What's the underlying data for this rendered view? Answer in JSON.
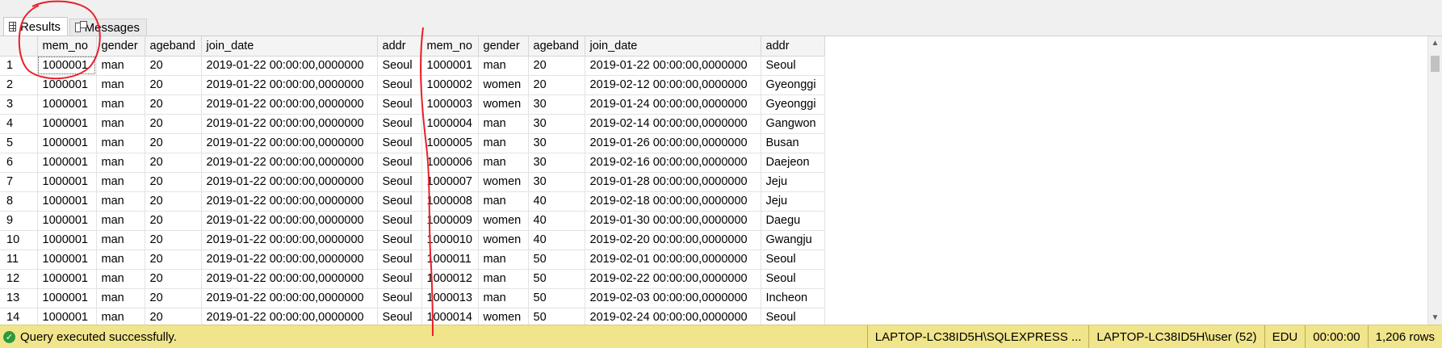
{
  "tabs": {
    "results": "Results",
    "messages": "Messages"
  },
  "columns": [
    "mem_no",
    "gender",
    "ageband",
    "join_date",
    "addr",
    "mem_no",
    "gender",
    "ageband",
    "join_date",
    "addr"
  ],
  "rows": [
    [
      "1",
      "1000001",
      "man",
      "20",
      "2019-01-22 00:00:00,0000000",
      "Seoul",
      "1000001",
      "man",
      "20",
      "2019-01-22 00:00:00,0000000",
      "Seoul"
    ],
    [
      "2",
      "1000001",
      "man",
      "20",
      "2019-01-22 00:00:00,0000000",
      "Seoul",
      "1000002",
      "women",
      "20",
      "2019-02-12 00:00:00,0000000",
      "Gyeonggi"
    ],
    [
      "3",
      "1000001",
      "man",
      "20",
      "2019-01-22 00:00:00,0000000",
      "Seoul",
      "1000003",
      "women",
      "30",
      "2019-01-24 00:00:00,0000000",
      "Gyeonggi"
    ],
    [
      "4",
      "1000001",
      "man",
      "20",
      "2019-01-22 00:00:00,0000000",
      "Seoul",
      "1000004",
      "man",
      "30",
      "2019-02-14 00:00:00,0000000",
      "Gangwon"
    ],
    [
      "5",
      "1000001",
      "man",
      "20",
      "2019-01-22 00:00:00,0000000",
      "Seoul",
      "1000005",
      "man",
      "30",
      "2019-01-26 00:00:00,0000000",
      "Busan"
    ],
    [
      "6",
      "1000001",
      "man",
      "20",
      "2019-01-22 00:00:00,0000000",
      "Seoul",
      "1000006",
      "man",
      "30",
      "2019-02-16 00:00:00,0000000",
      "Daejeon"
    ],
    [
      "7",
      "1000001",
      "man",
      "20",
      "2019-01-22 00:00:00,0000000",
      "Seoul",
      "1000007",
      "women",
      "30",
      "2019-01-28 00:00:00,0000000",
      "Jeju"
    ],
    [
      "8",
      "1000001",
      "man",
      "20",
      "2019-01-22 00:00:00,0000000",
      "Seoul",
      "1000008",
      "man",
      "40",
      "2019-02-18 00:00:00,0000000",
      "Jeju"
    ],
    [
      "9",
      "1000001",
      "man",
      "20",
      "2019-01-22 00:00:00,0000000",
      "Seoul",
      "1000009",
      "women",
      "40",
      "2019-01-30 00:00:00,0000000",
      "Daegu"
    ],
    [
      "10",
      "1000001",
      "man",
      "20",
      "2019-01-22 00:00:00,0000000",
      "Seoul",
      "1000010",
      "women",
      "40",
      "2019-02-20 00:00:00,0000000",
      "Gwangju"
    ],
    [
      "11",
      "1000001",
      "man",
      "20",
      "2019-01-22 00:00:00,0000000",
      "Seoul",
      "1000011",
      "man",
      "50",
      "2019-02-01 00:00:00,0000000",
      "Seoul"
    ],
    [
      "12",
      "1000001",
      "man",
      "20",
      "2019-01-22 00:00:00,0000000",
      "Seoul",
      "1000012",
      "man",
      "50",
      "2019-02-22 00:00:00,0000000",
      "Seoul"
    ],
    [
      "13",
      "1000001",
      "man",
      "20",
      "2019-01-22 00:00:00,0000000",
      "Seoul",
      "1000013",
      "man",
      "50",
      "2019-02-03 00:00:00,0000000",
      "Incheon"
    ],
    [
      "14",
      "1000001",
      "man",
      "20",
      "2019-01-22 00:00:00,0000000",
      "Seoul",
      "1000014",
      "women",
      "50",
      "2019-02-24 00:00:00,0000000",
      "Seoul"
    ]
  ],
  "status": {
    "message": "Query executed successfully.",
    "server": "LAPTOP-LC38ID5H\\SQLEXPRESS ...",
    "user": "LAPTOP-LC38ID5H\\user (52)",
    "database": "EDU",
    "elapsed": "00:00:00",
    "rows": "1,206 rows"
  },
  "colors": {
    "status_bg": "#f1e58c",
    "annotation": "#e8202a"
  }
}
